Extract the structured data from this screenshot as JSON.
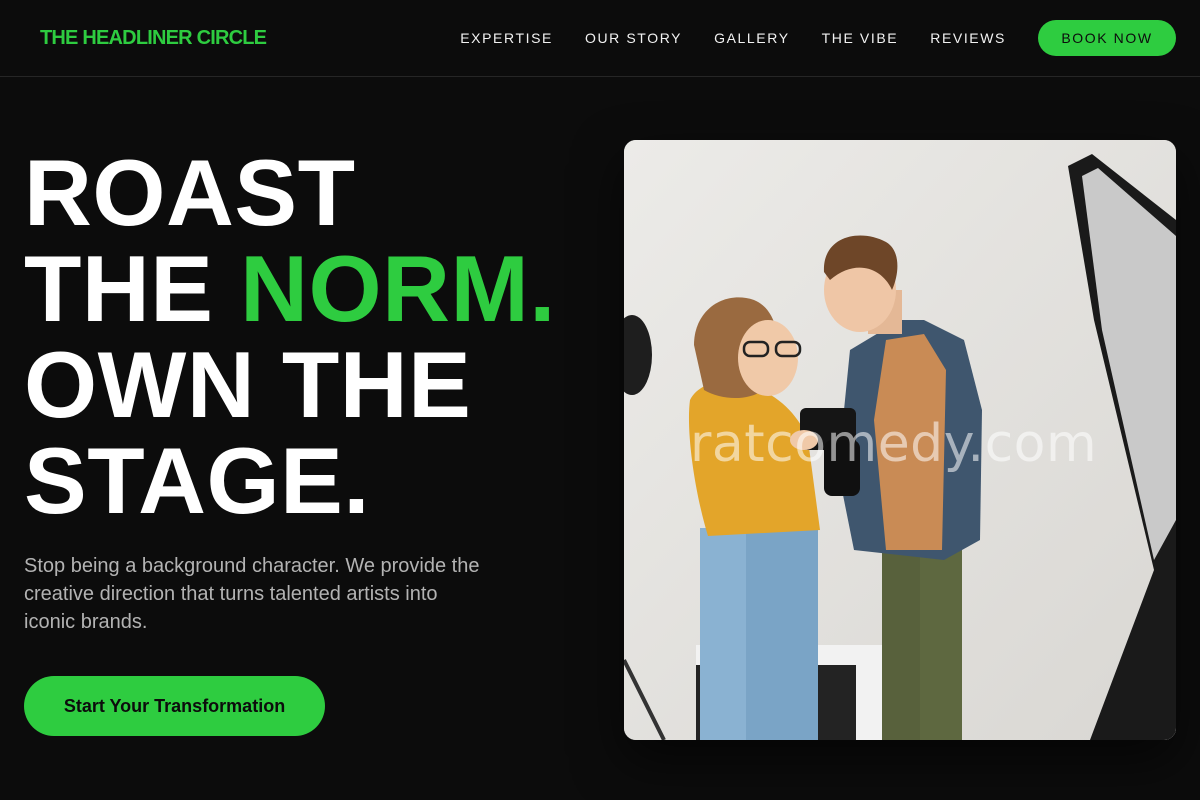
{
  "brand": {
    "name": "THE HEADLINER CIRCLE"
  },
  "nav": {
    "links": [
      "EXPERTISE",
      "OUR STORY",
      "GALLERY",
      "THE VIBE",
      "REVIEWS"
    ],
    "cta_label": "BOOK NOW"
  },
  "hero": {
    "title_line1": "ROAST",
    "title_line2_plain": "THE ",
    "title_line2_accent": "NORM.",
    "title_line3": "OWN THE",
    "title_line4": "STAGE.",
    "subtitle": "Stop being a background character. We provide the creative direction that turns talented artists into iconic brands.",
    "cta_label": "Start Your Transformation"
  },
  "image": {
    "watermark": "ratcomedy.com"
  },
  "colors": {
    "accent": "#2ecc40",
    "background": "#0c0c0c",
    "text": "#ffffff",
    "muted": "#b3b3b3"
  }
}
